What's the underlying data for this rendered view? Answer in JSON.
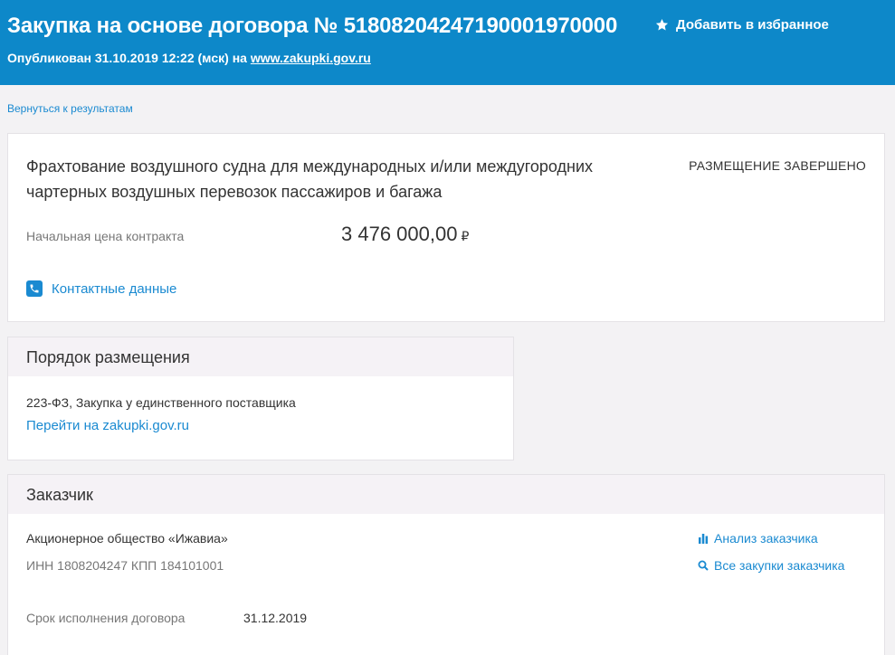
{
  "header": {
    "title": "Закупка на основе договора № 51808204247190001970000",
    "published_prefix": "Опубликован 31.10.2019 12:22 (мск) на ",
    "published_site": "www.zakupki.gov.ru",
    "favorite_label": "Добавить в избранное"
  },
  "nav": {
    "back_label": "Вернуться к результатам"
  },
  "summary": {
    "description": "Фрахтование воздушного судна для международных и/или междугородних чартерных воздушных перевозок пассажиров и багажа",
    "status": "РАЗМЕЩЕНИЕ ЗАВЕРШЕНО",
    "price_label": "Начальная цена контракта",
    "price_value": "3 476 000,00",
    "currency": "₽",
    "contacts_label": "Контактные данные"
  },
  "placement": {
    "heading": "Порядок размещения",
    "law_text": "223-ФЗ, Закупка у единственного поставщика",
    "link_label": "Перейти на zakupki.gov.ru"
  },
  "customer": {
    "heading": "Заказчик",
    "org_name": "Акционерное общество «Ижавиа»",
    "inn_kpp": "ИНН 1808204247 КПП 184101001",
    "analysis_label": "Анализ заказчика",
    "all_purchases_label": "Все закупки заказчика",
    "term_label": "Срок исполнения договора",
    "term_value": "31.12.2019"
  },
  "colors": {
    "header_bg": "#0d88c9",
    "link": "#1a8ad1",
    "page_bg": "#f3f2f4",
    "section_head_bg": "#f5f2f6"
  },
  "icons": {
    "favorite": "star-icon",
    "contacts": "phone-icon",
    "analysis": "bar-chart-icon",
    "all_purchases": "search-icon"
  }
}
